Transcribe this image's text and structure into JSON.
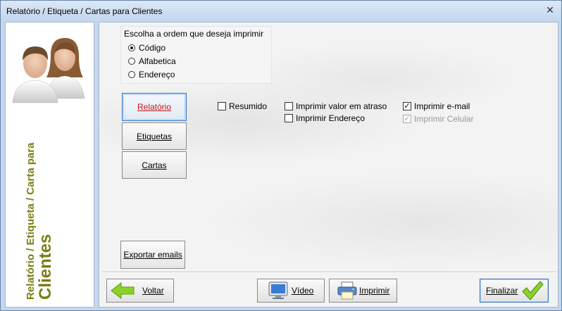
{
  "window": {
    "title": "Relatório / Etiqueta / Cartas para Clientes",
    "close_symbol": "✕"
  },
  "sidebar": {
    "title_line1": "Relatório / Etiqueta / Carta para",
    "title_line2": "Clientes"
  },
  "order": {
    "label": "Escolha a ordem que deseja imprimir",
    "options": [
      {
        "label": "Código",
        "checked": true
      },
      {
        "label": "Alfabetica",
        "checked": false
      },
      {
        "label": "Endereço",
        "checked": false
      }
    ]
  },
  "mode_buttons": {
    "relatorio": "Relatório",
    "etiquetas": "Etiquetas",
    "cartas": "Cartas",
    "exportar": "Exportar emails"
  },
  "options": {
    "resumido": {
      "label": "Resumido",
      "checked": false
    },
    "valor_atraso": {
      "label": "Imprimir valor em atraso",
      "checked": false
    },
    "endereco": {
      "label": "Imprimir Endereço",
      "checked": false
    },
    "email": {
      "label": "Imprimir e-mail",
      "checked": true
    },
    "celular": {
      "label": "Imprimir Celular",
      "checked": true,
      "disabled": true
    }
  },
  "footer": {
    "voltar": "Voltar",
    "video": "Vídeo",
    "imprimir": "Imprimir",
    "finalizar": "Finalizar"
  },
  "colors": {
    "sidebar_title": "#7a7d14",
    "active_button_text": "#d01010",
    "accent_border": "#3a7bd5"
  }
}
